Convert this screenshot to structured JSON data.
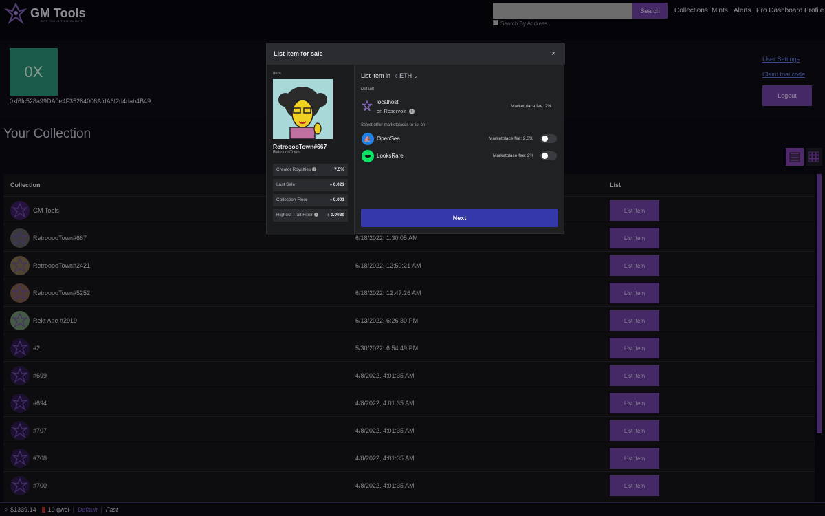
{
  "app": {
    "title": "GM Tools",
    "subtitle": "NFT TOOLS TO DOMINATE"
  },
  "search": {
    "button_label": "Search",
    "checkbox_label": "Search By Address",
    "placeholder": ""
  },
  "nav": [
    "Collections",
    "Mints",
    "Alerts",
    "Pro Dashboard",
    "Profile"
  ],
  "profile": {
    "avatar_text": "0X",
    "address": "0xf6fc528a99DA0e4F35284006AfdA6f2d4dab4B49",
    "links": [
      "User Settings",
      "Claim trial code"
    ],
    "logout_label": "Logout"
  },
  "collection": {
    "heading": "Your Collection",
    "columns": [
      "Collection",
      "List"
    ],
    "rows": [
      {
        "name": "GM Tools",
        "date": "",
        "action": "List Item"
      },
      {
        "name": "RetrooooTown#667",
        "date": "6/18/2022, 1:30:05 AM",
        "action": "List Item"
      },
      {
        "name": "RetrooooTown#2421",
        "date": "6/18/2022, 12:50:21 AM",
        "action": "List Item"
      },
      {
        "name": "RetrooooTown#5252",
        "date": "6/18/2022, 12:47:26 AM",
        "action": "List Item"
      },
      {
        "name": "Rekt Ape #2919",
        "date": "6/13/2022, 6:26:30 PM",
        "action": "List Item"
      },
      {
        "name": "#2",
        "date": "5/30/2022, 6:54:49 PM",
        "action": "List Item"
      },
      {
        "name": "#699",
        "date": "4/8/2022, 4:01:35 AM",
        "action": "List Item"
      },
      {
        "name": "#694",
        "date": "4/8/2022, 4:01:35 AM",
        "action": "List Item"
      },
      {
        "name": "#707",
        "date": "4/8/2022, 4:01:35 AM",
        "action": "List Item"
      },
      {
        "name": "#708",
        "date": "4/8/2022, 4:01:35 AM",
        "action": "List Item"
      },
      {
        "name": "#700",
        "date": "4/8/2022, 4:01:35 AM",
        "action": "List Item"
      }
    ]
  },
  "footer": {
    "eth_price": "$1339.14",
    "gas": "10 gwei",
    "default_label": "Default",
    "fast_label": "Fast"
  },
  "modal": {
    "title": "List Item for sale",
    "close": "×",
    "item_label": "Item",
    "item_name": "RetrooooTown#667",
    "item_collection": "RetrooooTown",
    "stats": [
      {
        "label": "Creator Royalties",
        "value": "7.5%"
      },
      {
        "label": "Last Sale",
        "value": "0.021"
      },
      {
        "label": "Collection Floor",
        "value": "0.001"
      },
      {
        "label": "Highest Trait Floor",
        "value": "0.0039"
      }
    ],
    "list_in_label": "List item in",
    "currency": "ETH",
    "default_label": "Default",
    "default_market": {
      "name": "localhost",
      "sub": "on Reservoir",
      "fee": "Marketplace fee: 2%"
    },
    "other_label": "Select other marketplaces to list on",
    "markets": [
      {
        "name": "OpenSea",
        "fee": "Marketplace fee: 2.5%",
        "enabled": false
      },
      {
        "name": "LooksRare",
        "fee": "Marketplace fee: 2%",
        "enabled": false
      }
    ],
    "next_label": "Next"
  }
}
